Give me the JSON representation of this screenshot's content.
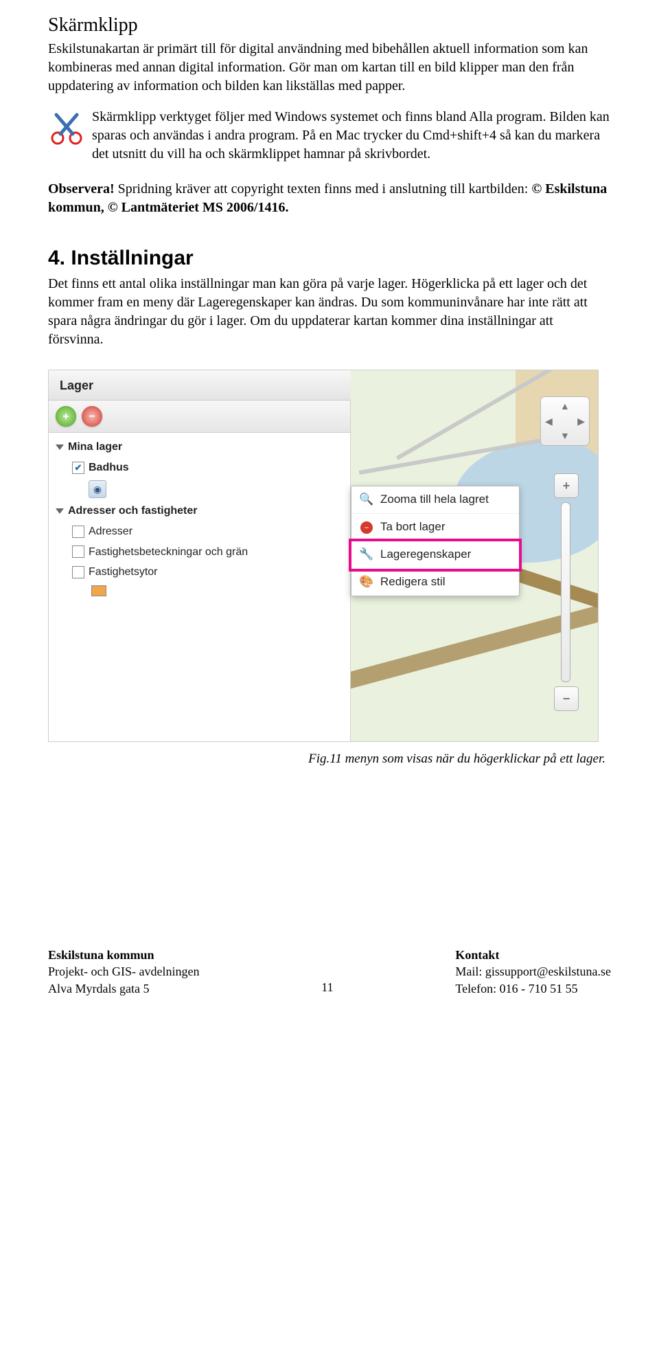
{
  "section": {
    "title": "Skärmklipp",
    "p1": "Eskilstunakartan är primärt till för digital användning med bibehållen aktuell information som kan kombineras med annan digital information. Gör man om kartan till en bild klipper man den från uppdatering av information och bilden kan likställas med papper.",
    "p2": "Skärmklipp verktyget följer med Windows systemet och finns bland Alla program. Bilden kan sparas och användas i andra program. På en Mac trycker du Cmd+shift+4 så kan du markera det utsnitt du vill ha och skärmklippet hamnar på skrivbordet.",
    "observe_label": "Observera!",
    "observe_text": " Spridning kräver att copyright texten finns med i anslutning till kartbilden: ",
    "observe_bold2": "© Eskilstuna kommun, © Lantmäteriet MS 2006/1416."
  },
  "settings": {
    "heading": "4. Inställningar",
    "body": "Det finns ett antal olika inställningar man kan göra på varje lager. Högerklicka på ett lager och det kommer fram en meny där Lageregenskaper kan ändras. Du som kommuninvånare har inte rätt att spara några ändringar du gör i lager. Om du uppdaterar kartan kommer dina inställningar att försvinna."
  },
  "screenshot": {
    "panel_title": "Lager",
    "groups": {
      "mina": "Mina lager",
      "badhus": "Badhus",
      "adr_fast": "Adresser och fastigheter",
      "adresser": "Adresser",
      "fastbet": "Fastighetsbeteckningar och grän",
      "fastytor": "Fastighetsytor"
    },
    "context_menu": {
      "zoom": "Zooma till hela lagret",
      "remove": "Ta bort lager",
      "props": "Lageregenskaper",
      "style": "Redigera stil"
    }
  },
  "caption": "Fig.11 menyn som visas när du högerklickar på ett lager.",
  "footer": {
    "org": "Eskilstuna kommun",
    "dept": "Projekt- och GIS- avdelningen",
    "street": "Alva Myrdals gata 5",
    "page_number": "11",
    "contact_label": "Kontakt",
    "mail": "Mail: gissupport@eskilstuna.se",
    "phone": "Telefon: 016 - 710 51 55"
  }
}
